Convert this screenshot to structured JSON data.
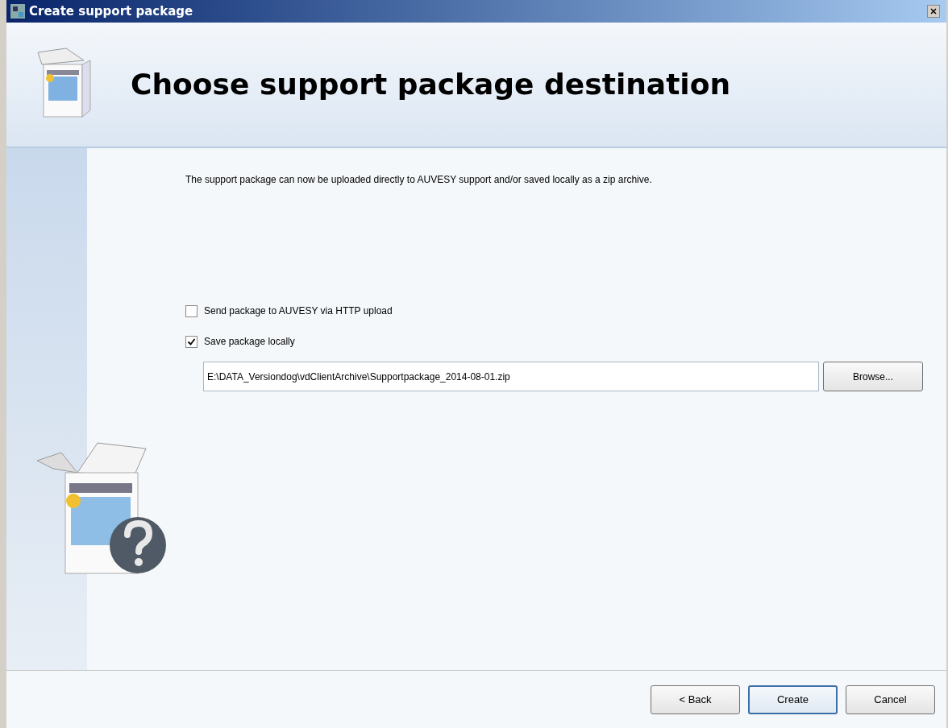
{
  "window": {
    "title": "Create support package"
  },
  "header": {
    "heading": "Choose support package destination"
  },
  "description": "The support package can now be uploaded directly to AUVESY support and/or saved locally as a zip archive.",
  "options": [
    {
      "label": "Send package to AUVESY via HTTP upload",
      "checked": false
    },
    {
      "label": "Save package locally",
      "checked": true
    }
  ],
  "path_field": {
    "value": "E:\\DATA_Versiondog\\vdClientArchive\\Supportpackage_2014-08-01.zip"
  },
  "browse_button": "Browse...",
  "buttons": [
    {
      "label": "< Back",
      "default": false
    },
    {
      "label": "Create",
      "default": true
    },
    {
      "label": "Cancel",
      "default": false
    }
  ]
}
